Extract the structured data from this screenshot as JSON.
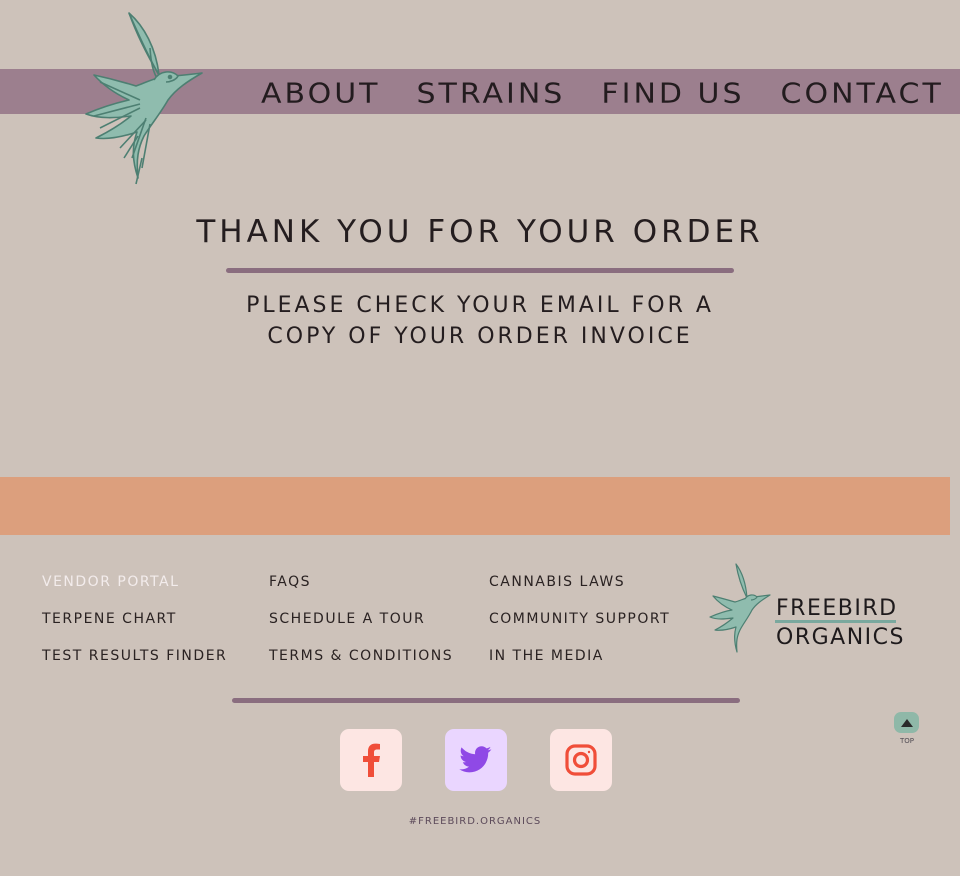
{
  "header": {
    "nav": [
      {
        "label": "ABOUT"
      },
      {
        "label": "STRAINS"
      },
      {
        "label": "FIND US"
      },
      {
        "label": "CONTACT"
      }
    ],
    "logo_icon": "hummingbird-leaf-icon"
  },
  "main": {
    "title": "THANK YOU FOR YOUR ORDER",
    "message_line1": "PLEASE CHECK YOUR EMAIL FOR A",
    "message_line2": "COPY OF YOUR ORDER INVOICE"
  },
  "footer": {
    "links": {
      "col1": [
        "VENDOR PORTAL",
        "TERPENE CHART",
        "TEST RESULTS FINDER"
      ],
      "col2": [
        "FAQS",
        "SCHEDULE A TOUR",
        "TERMS & CONDITIONS"
      ],
      "col3": [
        "CANNABIS LAWS",
        "COMMUNITY SUPPORT",
        "IN THE MEDIA"
      ]
    },
    "brand": {
      "line1": "FREEBIRD",
      "line2": "ORGANICS"
    },
    "social": [
      {
        "icon": "facebook-icon",
        "color": "#f04e39",
        "bg": "#fde6e3"
      },
      {
        "icon": "twitter-icon",
        "color": "#8f49e6",
        "bg": "#ead6ff"
      },
      {
        "icon": "instagram-icon",
        "color": "#f04e39",
        "bg": "#fde6e3"
      }
    ],
    "hashtag": "#FREEBIRD.ORGANICS",
    "top_label": "TOP"
  },
  "colors": {
    "background": "#cdc2ba",
    "nav_bar": "#9c7f8e",
    "accent_orange": "#dc9f7d",
    "accent_teal": "#8fb8a8",
    "divider": "#8a6d7f"
  }
}
